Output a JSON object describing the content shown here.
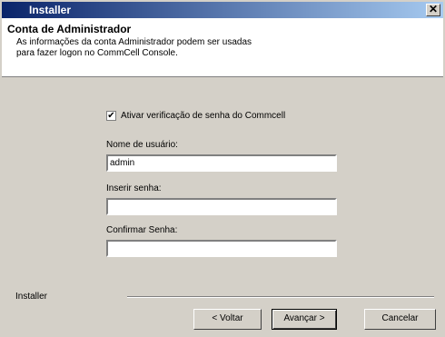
{
  "window": {
    "title": "Installer",
    "close_symbol": "✕"
  },
  "header": {
    "title": "Conta de Administrador",
    "description": "As informações da conta Administrador podem ser usadas para fazer logon no CommCell Console."
  },
  "form": {
    "checkbox_label": "Ativar verificação de senha do Commcell",
    "checkbox_checked": true,
    "username_label": "Nome de usuário:",
    "username_value": "admin",
    "password_label": "Inserir senha:",
    "password_value": "",
    "confirm_label": "Confirmar Senha:",
    "confirm_value": ""
  },
  "footer": {
    "installer_label": "Installer",
    "back_label": "< Voltar",
    "next_label": "Avançar >",
    "cancel_label": "Cancelar"
  }
}
